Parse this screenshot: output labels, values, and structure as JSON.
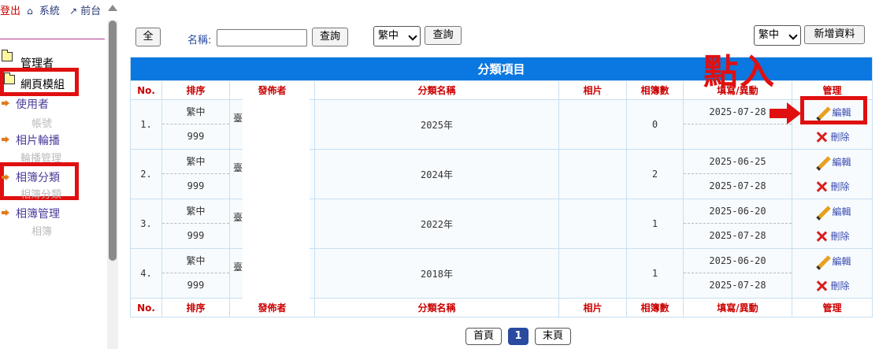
{
  "top_links": {
    "logout": "登出",
    "system": "系統",
    "frontend": "前台"
  },
  "sidebar": {
    "admin": "管理者",
    "module": "網頁模組",
    "items": [
      {
        "label": "使用者",
        "sub": "帳號"
      },
      {
        "label": "相片輪播",
        "sub": "輪播管理"
      },
      {
        "label": "相簿分類",
        "sub": "相簿分類"
      },
      {
        "label": "相簿管理",
        "sub": "相簿"
      }
    ]
  },
  "toolbar": {
    "all_label": "全",
    "name_label": "名稱:",
    "search_label": "查詢",
    "lang_select": "繁中",
    "search2_label": "查詢",
    "lang_select_right": "繁中",
    "add_label": "新增資料"
  },
  "annotation": {
    "text": "點入"
  },
  "table": {
    "caption": "分類項目",
    "headers": [
      "No.",
      "排序",
      "發佈者",
      "分類名稱",
      "相片",
      "相簿數",
      "填寫/異動",
      "管理"
    ],
    "edit_label": "編輯",
    "delete_label": "刪除",
    "rows": [
      {
        "no": "1.",
        "lang": "繁中",
        "order": "999",
        "publisher": "臺",
        "name": "2025年",
        "photo": "",
        "count": "0",
        "created": "2025-07-28",
        "modified": ""
      },
      {
        "no": "2.",
        "lang": "繁中",
        "order": "999",
        "publisher": "臺",
        "name": "2024年",
        "photo": "",
        "count": "2",
        "created": "2025-06-25",
        "modified": "2025-07-28"
      },
      {
        "no": "3.",
        "lang": "繁中",
        "order": "999",
        "publisher": "臺",
        "name": "2022年",
        "photo": "",
        "count": "1",
        "created": "2025-06-20",
        "modified": "2025-07-28"
      },
      {
        "no": "4.",
        "lang": "繁中",
        "order": "999",
        "publisher": "臺",
        "name": "2018年",
        "photo": "",
        "count": "1",
        "created": "2025-06-20",
        "modified": "2025-07-28"
      }
    ]
  },
  "pager": {
    "first": "首頁",
    "current": "1",
    "last": "末頁"
  }
}
